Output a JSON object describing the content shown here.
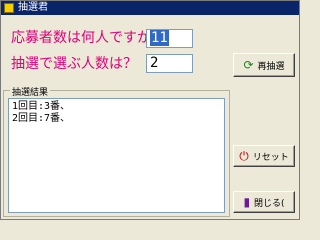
{
  "window": {
    "title": "抽選君",
    "icon": "app-icon"
  },
  "question1": {
    "label": "応募者数は何人ですか？",
    "value": "11"
  },
  "question2": {
    "label": "抽選で選ぶ人数は？",
    "value": "2"
  },
  "buttons": {
    "redraw": {
      "label": "再抽選",
      "icon": "refresh-icon"
    },
    "reset": {
      "label": "リセット",
      "icon": "reset-icon"
    },
    "close": {
      "label": "閉じる(",
      "icon": "door-icon"
    }
  },
  "results": {
    "legend": "抽選結果",
    "lines": [
      "1回目:3番、",
      "2回目:7番、"
    ]
  },
  "colors": {
    "accent_text": "#e0007a",
    "titlebar": "#0a246a",
    "selection": "#316ac5"
  }
}
